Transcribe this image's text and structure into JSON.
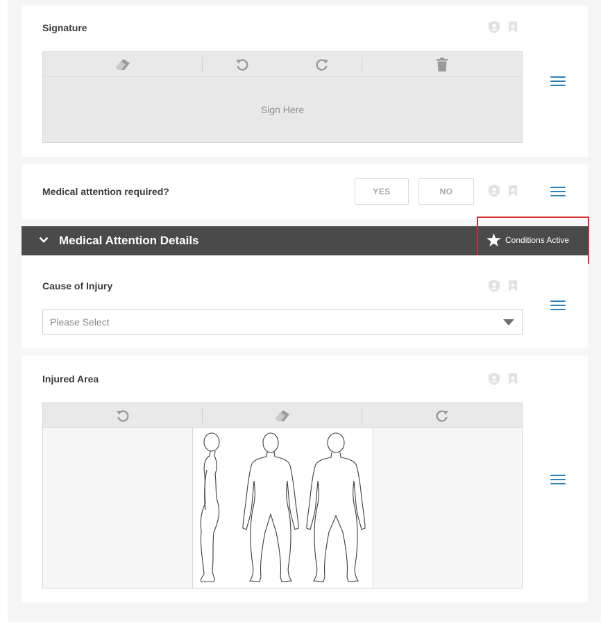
{
  "signature": {
    "label": "Signature",
    "placeholder": "Sign Here",
    "toolbar_icons": [
      "eraser-icon",
      "undo-icon",
      "redo-icon",
      "trash-icon"
    ]
  },
  "medical_attention": {
    "label": "Medical attention required?",
    "yes_label": "YES",
    "no_label": "NO"
  },
  "section": {
    "title": "Medical Attention Details",
    "conditions_label": "Conditions Active",
    "highlight_color": "#d62b2b"
  },
  "cause": {
    "label": "Cause of Injury",
    "select_value": "Please Select"
  },
  "injured_area": {
    "label": "Injured Area",
    "toolbar_icons": [
      "undo-icon",
      "eraser-icon",
      "redo-icon"
    ]
  },
  "colors": {
    "accent": "#2c7fb8",
    "section_bar": "#4a4a4a",
    "toolbar_bg": "#e9e9e9",
    "canvas_bg": "#e8e8e8"
  }
}
